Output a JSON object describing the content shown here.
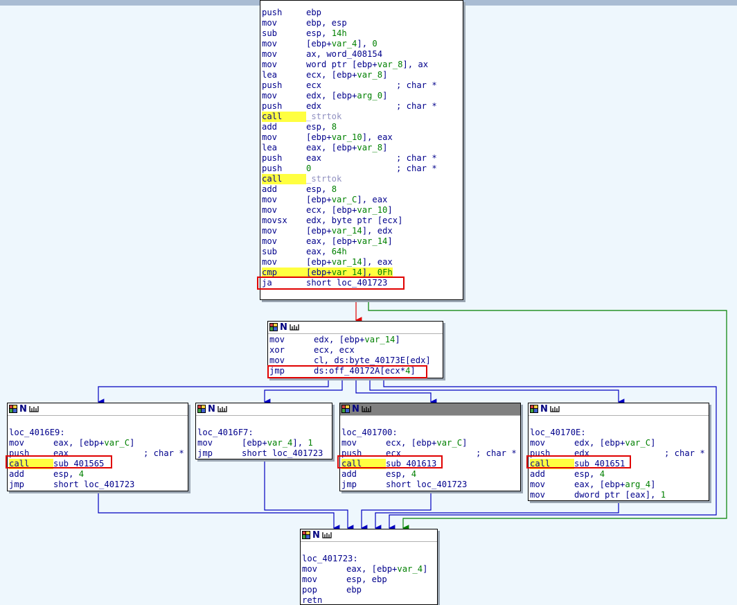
{
  "nodes": {
    "entry": {
      "partial_line": "",
      "lines": [
        [
          "push",
          "ebp"
        ],
        [
          "mov",
          "ebp, esp"
        ],
        [
          "sub",
          "esp, 14h"
        ],
        [
          "mov",
          "[ebp+var_4], 0"
        ],
        [
          "mov",
          "ax, word_408154"
        ],
        [
          "mov",
          "word ptr [ebp+var_8], ax"
        ],
        [
          "lea",
          "ecx, [ebp+var_8]"
        ],
        [
          "push",
          "ecx",
          "; char *"
        ],
        [
          "mov",
          "edx, [ebp+arg_0]"
        ],
        [
          "push",
          "edx",
          "; char *"
        ],
        [
          "call",
          "_strtok"
        ],
        [
          "add",
          "esp, 8"
        ],
        [
          "mov",
          "[ebp+var_10], eax"
        ],
        [
          "lea",
          "eax, [ebp+var_8]"
        ],
        [
          "push",
          "eax",
          "; char *"
        ],
        [
          "push",
          "0",
          "; char *"
        ],
        [
          "call",
          "_strtok"
        ],
        [
          "add",
          "esp, 8"
        ],
        [
          "mov",
          "[ebp+var_C], eax"
        ],
        [
          "mov",
          "ecx, [ebp+var_10]"
        ],
        [
          "movsx",
          "edx, byte ptr [ecx]"
        ],
        [
          "mov",
          "[ebp+var_14], edx"
        ],
        [
          "mov",
          "eax, [ebp+var_14]"
        ],
        [
          "sub",
          "eax, 64h"
        ],
        [
          "mov",
          "[ebp+var_14], eax"
        ],
        [
          "cmp",
          "[ebp+var_14], 0Fh"
        ],
        [
          "ja",
          "short loc_401723"
        ]
      ]
    },
    "dispatch": {
      "lines": [
        [
          "mov",
          "edx, [ebp+var_14]"
        ],
        [
          "xor",
          "ecx, ecx"
        ],
        [
          "mov",
          "cl, ds:byte_40173E[edx]"
        ],
        [
          "jmp",
          "ds:off_40172A[ecx*4]"
        ]
      ]
    },
    "case1": {
      "label": "loc_4016E9:",
      "lines": [
        [
          "mov",
          "eax, [ebp+var_C]"
        ],
        [
          "push",
          "eax",
          "; char *"
        ],
        [
          "call",
          "sub_401565"
        ],
        [
          "add",
          "esp, 4"
        ],
        [
          "jmp",
          "short loc_401723"
        ]
      ]
    },
    "case2": {
      "label": "loc_4016F7:",
      "lines": [
        [
          "mov",
          "[ebp+var_4], 1"
        ],
        [
          "jmp",
          "short loc_401723"
        ]
      ]
    },
    "case3": {
      "label": "loc_401700:",
      "lines": [
        [
          "mov",
          "ecx, [ebp+var_C]"
        ],
        [
          "push",
          "ecx",
          "; char *"
        ],
        [
          "call",
          "sub_401613"
        ],
        [
          "add",
          "esp, 4"
        ],
        [
          "jmp",
          "short loc_401723"
        ]
      ]
    },
    "case4": {
      "label": "loc_40170E:",
      "lines": [
        [
          "mov",
          "edx, [ebp+var_C]"
        ],
        [
          "push",
          "edx",
          "; char *"
        ],
        [
          "call",
          "sub_401651"
        ],
        [
          "add",
          "esp, 4"
        ],
        [
          "mov",
          "eax, [ebp+arg_4]"
        ],
        [
          "mov",
          "dword ptr [eax], 1"
        ]
      ]
    },
    "exit": {
      "label": "loc_401723:",
      "lines": [
        [
          "mov",
          "eax, [ebp+var_4]"
        ],
        [
          "mov",
          "esp, ebp"
        ],
        [
          "pop",
          "ebp"
        ],
        [
          "retn",
          ""
        ]
      ]
    }
  },
  "header_icon_names": [
    "graph-node-color-icon",
    "node-letter-icon",
    "graph-overview-icon"
  ],
  "header_letter": "N",
  "colors": {
    "background": "#eef7fd",
    "edge_true": "#008000",
    "edge_false": "#e00000",
    "edge_flow": "#0000c0",
    "highlight": "#ffff40",
    "annotation_box": "#e00000"
  }
}
